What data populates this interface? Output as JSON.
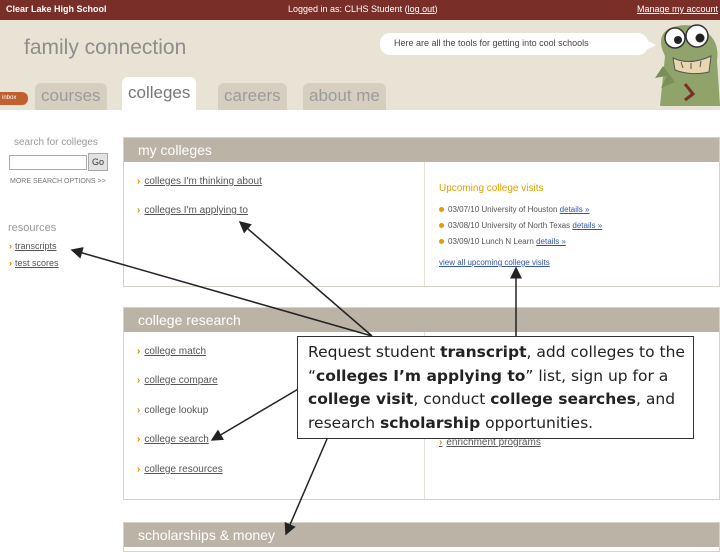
{
  "topbar": {
    "school": "Clear Lake High School",
    "logged_in_prefix": "Logged in as: CLHS Student (",
    "logout": "log out",
    "logged_in_suffix": ")",
    "manage_account": "Manage my account"
  },
  "header": {
    "brand": "family connection",
    "bubble_text": "Here are all the tools for getting into cool schools",
    "nav_arrow": "inbox"
  },
  "tabs": [
    {
      "label": "courses",
      "active": false
    },
    {
      "label": "colleges",
      "active": true
    },
    {
      "label": "careers",
      "active": false
    },
    {
      "label": "about me",
      "active": false
    }
  ],
  "sidebar": {
    "search_label": "search for colleges",
    "search_value": "",
    "go_label": "Go",
    "more_options": "MORE SEARCH OPTIONS >>",
    "resources_label": "resources",
    "links": [
      "transcripts",
      "test scores"
    ]
  },
  "my_colleges": {
    "title": "my colleges",
    "links": [
      "colleges I'm thinking about",
      "colleges I'm applying to"
    ],
    "visits_title": "Upcoming college visits",
    "visits": [
      {
        "date": "03/07/10",
        "school": "University of Houston",
        "link": "details »"
      },
      {
        "date": "03/08/10",
        "school": "University of North Texas",
        "link": "details »"
      },
      {
        "date": "03/09/10",
        "school": "Lunch N Learn",
        "link": "details »"
      }
    ],
    "view_all": "view all upcoming college visits"
  },
  "college_research": {
    "title": "college research",
    "links": [
      "college match",
      "college compare",
      "college lookup",
      "college search",
      "college resources"
    ],
    "right_links": [
      "enrichment programs"
    ]
  },
  "scholarships": {
    "title": "scholarships & money"
  },
  "callout": {
    "p1": "Request student ",
    "b1": "transcript",
    "p2": ", add colleges to the “",
    "b2": "colleges I’m applying to",
    "p3": "” list, sign up for a ",
    "b3": "college visit",
    "p4": ", conduct ",
    "b4": "college searches",
    "p5": ", and research ",
    "b5": "scholarship",
    "p6": " opportunities."
  }
}
